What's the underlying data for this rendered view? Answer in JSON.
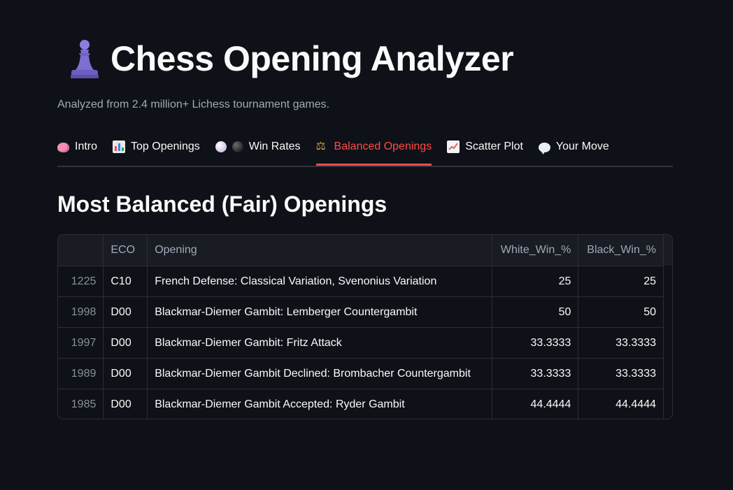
{
  "header": {
    "title": "Chess Opening Analyzer",
    "subtitle": "Analyzed from 2.4 million+ Lichess tournament games."
  },
  "tabs": [
    {
      "label": "Intro",
      "icon": "brain-icon",
      "active": false
    },
    {
      "label": "Top Openings",
      "icon": "bar-chart-icon",
      "active": false
    },
    {
      "label": "Win Rates",
      "icon": "white-black-circles-icon",
      "active": false
    },
    {
      "label": "Balanced Openings",
      "icon": "balance-scale-icon",
      "active": true
    },
    {
      "label": "Scatter Plot",
      "icon": "trend-chart-icon",
      "active": false
    },
    {
      "label": "Your Move",
      "icon": "speech-bubble-icon",
      "active": false
    }
  ],
  "section": {
    "title": "Most Balanced (Fair) Openings"
  },
  "table": {
    "columns": [
      "",
      "ECO",
      "Opening",
      "White_Win_%",
      "Black_Win_%"
    ],
    "rows": [
      {
        "index": "1225",
        "eco": "C10",
        "opening": "French Defense: Classical Variation, Svenonius Variation",
        "white": "25",
        "black": "25"
      },
      {
        "index": "1998",
        "eco": "D00",
        "opening": "Blackmar-Diemer Gambit: Lemberger Countergambit",
        "white": "50",
        "black": "50"
      },
      {
        "index": "1997",
        "eco": "D00",
        "opening": "Blackmar-Diemer Gambit: Fritz Attack",
        "white": "33.3333",
        "black": "33.3333"
      },
      {
        "index": "1989",
        "eco": "D00",
        "opening": "Blackmar-Diemer Gambit Declined: Brombacher Countergambit",
        "white": "33.3333",
        "black": "33.3333"
      },
      {
        "index": "1985",
        "eco": "D00",
        "opening": "Blackmar-Diemer Gambit Accepted: Ryder Gambit",
        "white": "44.4444",
        "black": "44.4444"
      }
    ]
  },
  "colors": {
    "background": "#0e1117",
    "accent": "#ff4b4b",
    "pawn": "#7b6fd0"
  }
}
